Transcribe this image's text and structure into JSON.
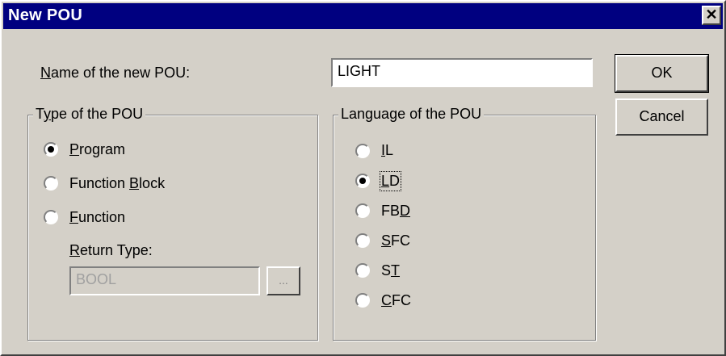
{
  "window": {
    "title": "New POU",
    "close_glyph": "✕"
  },
  "name_field": {
    "label_prefix": "",
    "label_mnemonic": "N",
    "label_rest": "ame of the new POU:",
    "value": "LIGHT"
  },
  "buttons": {
    "ok": "OK",
    "cancel": "Cancel",
    "browse": "..."
  },
  "type_group": {
    "title_prefix": "T",
    "title_mnemonic": "y",
    "title_rest": "pe of the POU",
    "options": [
      {
        "pre": "",
        "mn": "P",
        "post": "rogram",
        "selected": true
      },
      {
        "pre": "Function ",
        "mn": "B",
        "post": "lock",
        "selected": false
      },
      {
        "pre": "",
        "mn": "F",
        "post": "unction",
        "selected": false
      }
    ],
    "return_type": {
      "label_prefix": "",
      "label_mnemonic": "R",
      "label_rest": "eturn Type:",
      "value": "BOOL"
    }
  },
  "language_group": {
    "title": "Language of the POU",
    "options": [
      {
        "pre": "",
        "mn": "I",
        "post": "L",
        "selected": false
      },
      {
        "pre": "",
        "mn": "L",
        "post": "D",
        "selected": true
      },
      {
        "pre": "FB",
        "mn": "D",
        "post": "",
        "selected": false
      },
      {
        "pre": "",
        "mn": "S",
        "post": "FC",
        "selected": false
      },
      {
        "pre": "S",
        "mn": "T",
        "post": "",
        "selected": false
      },
      {
        "pre": "",
        "mn": "C",
        "post": "FC",
        "selected": false
      }
    ]
  }
}
